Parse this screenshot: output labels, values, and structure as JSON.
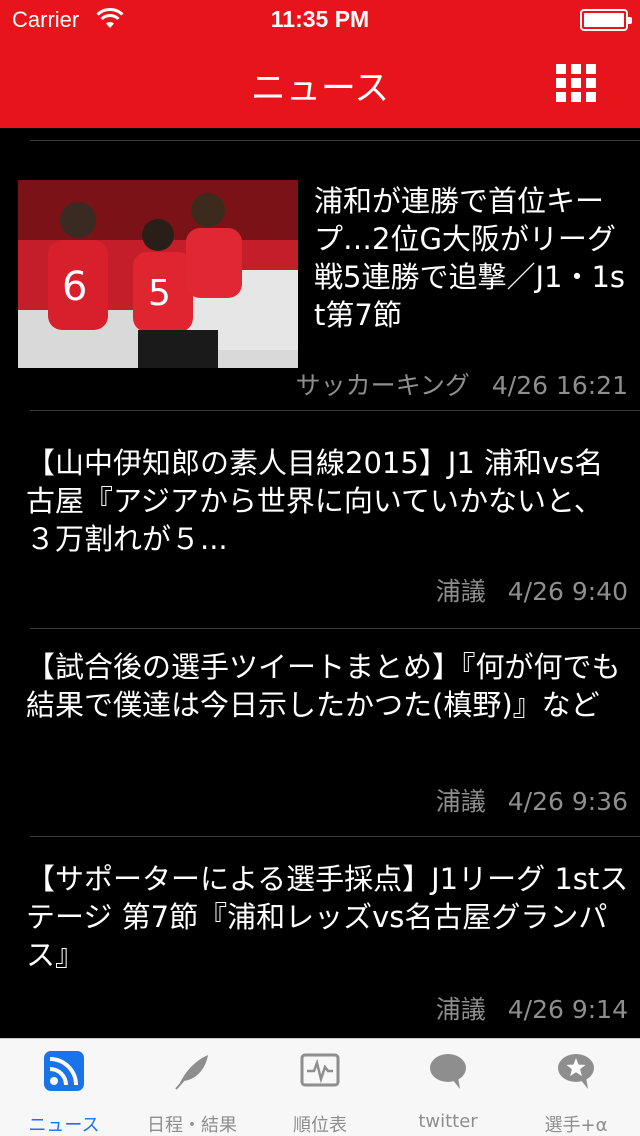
{
  "status_bar": {
    "carrier": "Carrier",
    "time": "11:35 PM"
  },
  "nav": {
    "title": "ニュース",
    "menu_icon": "grid-icon"
  },
  "news": [
    {
      "title": "浦和が連勝で首位キープ…2位G大阪がリーグ戦5連勝で追撃／J1・1st第7節",
      "source": "サッカーキング",
      "date": "4/26 16:21",
      "has_image": true
    },
    {
      "title": "【山中伊知郎の素人目線2015】J1 浦和vs名古屋『アジアから世界に向いていかないと、３万割れが５...",
      "source": "浦議",
      "date": "4/26 9:40"
    },
    {
      "title": "【試合後の選手ツイートまとめ】『何が何でも結果で僕達は今日示したかつた(槙野)』など",
      "source": "浦議",
      "date": "4/26 9:36"
    },
    {
      "title": "【サポーターによる選手採点】J1リーグ 1stステージ 第7節『浦和レッズvs名古屋グランパス』",
      "source": "浦議",
      "date": "4/26 9:14"
    }
  ],
  "tabs": [
    {
      "label": "ニュース",
      "icon": "rss-icon",
      "active": true
    },
    {
      "label": "日程・結果",
      "icon": "feather-icon"
    },
    {
      "label": "順位表",
      "icon": "chart-monitor-icon"
    },
    {
      "label": "twitter",
      "icon": "speech-bubble-icon"
    },
    {
      "label": "選手+α",
      "icon": "star-bubble-icon"
    }
  ],
  "colors": {
    "header_bg": "#e8141b",
    "list_bg": "#000000",
    "tab_active": "#1a73e8",
    "tab_inactive": "#8e8e8e"
  }
}
